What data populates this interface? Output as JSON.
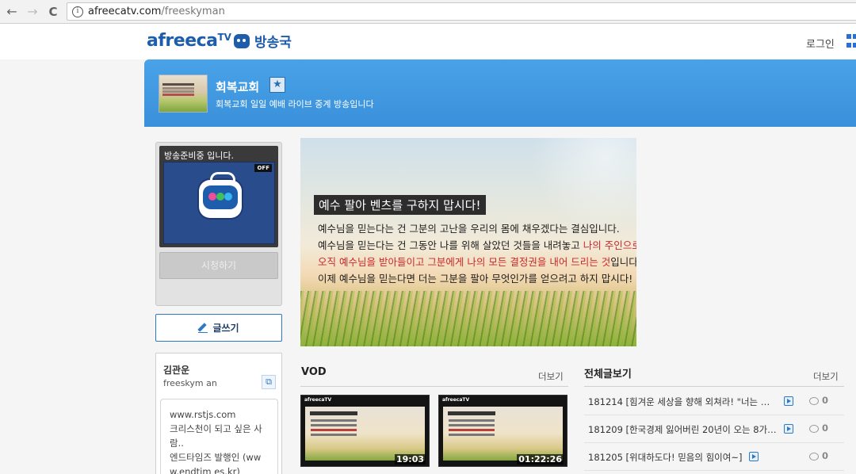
{
  "browser": {
    "url_domain": "afreecatv.com",
    "url_path": "/freeskyman",
    "back_glyph": "←",
    "forward_glyph": "→",
    "reload_glyph": "C",
    "info_glyph": "i"
  },
  "site": {
    "logo_text": "afreeca",
    "logo_tv": "TV",
    "logo_sub": "방송국",
    "login_label": "로그인",
    "brand_color": "#1e5dab"
  },
  "channel": {
    "name": "회복교회",
    "description": "회복교회 일일 예배 라이브 중계 방송입니다",
    "star_glyph": "★",
    "header_color": "#3a90da"
  },
  "live": {
    "status_text": "방송준비중 입니다.",
    "off_badge": "OFF",
    "watch_button": "시청하기"
  },
  "write_button": "글쓰기",
  "profile": {
    "name": "김관운",
    "user_id": "freeskym an",
    "share_glyph": "⧉",
    "bio_lines": [
      "www.rstjs.com",
      "크리스천이 되고 싶은 사",
      "람..",
      "엔드타임즈 발행인 (ww",
      "w.endtim es.kr)"
    ]
  },
  "banner": {
    "title": "예수 팔아 벤츠를 구하지 맙시다!",
    "line1": "예수님을 믿는다는 건 그분의 고난을 우리의 몸에 채우겠다는 결심입니다.",
    "line2_pre": "예수님을 믿는다는 건 그동안 나를 위해 살았던 것들을 내려놓고 ",
    "line2_red": "나의 주인으로",
    "line3_red": "오직 예수님을 받아들이고 그분에게 나의 모든 결정권을 내어 드리는 것",
    "line3_post": "입니다.",
    "line4": "이제 예수님을 믿는다면 더는 그분을 팔아 무엇인가를 얻으려고 하지 맙시다!"
  },
  "vod": {
    "title": "VOD",
    "more": "더보기",
    "items": [
      {
        "duration": "19:03",
        "logo": "afreecaTV"
      },
      {
        "duration": "01:22:26",
        "logo": "afreecaTV"
      }
    ]
  },
  "board": {
    "title": "전체글보기",
    "more": "더보기",
    "posts": [
      {
        "title": "181214 [힘겨운 세상을 향해 외쳐라! \"너는 …",
        "comments": "0"
      },
      {
        "title": "181209 [한국경제 잃어버린 20년이 오는 8가…",
        "comments": "0"
      },
      {
        "title": "181205 [위대하도다! 믿음의 힘이여~]",
        "comments": "0"
      }
    ]
  }
}
